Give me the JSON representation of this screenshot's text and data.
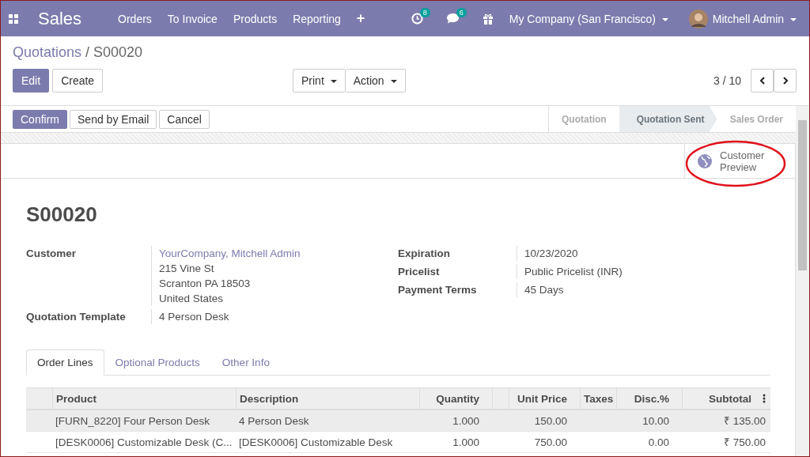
{
  "navbar": {
    "app": "Sales",
    "menu": [
      "Orders",
      "To Invoice",
      "Products",
      "Reporting",
      "+"
    ],
    "activity_count": "8",
    "message_count": "6",
    "company": "My Company (San Francisco)",
    "user": "Mitchell Admin"
  },
  "breadcrumb": {
    "parent": "Quotations",
    "separator": "/",
    "current": "S00020"
  },
  "control_panel": {
    "primary": "Edit",
    "secondary": "Create",
    "dropdowns": [
      "Print",
      "Action"
    ],
    "pager": "3 / 10"
  },
  "statusbar": {
    "buttons": [
      {
        "label": "Confirm",
        "primary": true
      },
      {
        "label": "Send by Email",
        "primary": false
      },
      {
        "label": "Cancel",
        "primary": false
      }
    ],
    "stages": [
      {
        "label": "Quotation",
        "selected": false
      },
      {
        "label": "Quotation Sent",
        "selected": true
      },
      {
        "label": "Sales Order",
        "selected": false
      }
    ]
  },
  "smart_button": {
    "label_lines": [
      "Customer",
      "Preview"
    ],
    "highlighted": true
  },
  "record": {
    "name": "S00020",
    "left_fields": [
      {
        "label": "Customer",
        "link": "YourCompany, Mitchell Admin",
        "lines": [
          "215 Vine St",
          "Scranton PA 18503",
          "United States"
        ]
      },
      {
        "label": "Quotation Template",
        "lines": [
          "4 Person Desk"
        ]
      }
    ],
    "right_fields": [
      {
        "label": "Expiration",
        "lines": [
          "10/23/2020"
        ]
      },
      {
        "label": "Pricelist",
        "lines": [
          "Public Pricelist (INR)"
        ]
      },
      {
        "label": "Payment Terms",
        "lines": [
          "45 Days"
        ]
      }
    ]
  },
  "tabs": [
    {
      "label": "Order Lines",
      "selected": true
    },
    {
      "label": "Optional Products",
      "selected": false
    },
    {
      "label": "Other Info",
      "selected": false
    }
  ],
  "table": {
    "columns": [
      "Product",
      "Description",
      "Quantity",
      "",
      "Unit Price",
      "Taxes",
      "Disc.%",
      "Subtotal"
    ],
    "rows": [
      {
        "selected": true,
        "cells": [
          "[FURN_8220] Four Person Desk",
          "4 Person Desk",
          "1.000",
          "",
          "150.00",
          "",
          "10.00",
          "₹ 135.00"
        ]
      },
      {
        "selected": false,
        "cells": [
          "[DESK0006] Customizable Desk (C...",
          "[DESK0006] Customizable Desk",
          "1.000",
          "",
          "750.00",
          "",
          "0.00",
          "₹ 750.00"
        ]
      }
    ]
  }
}
